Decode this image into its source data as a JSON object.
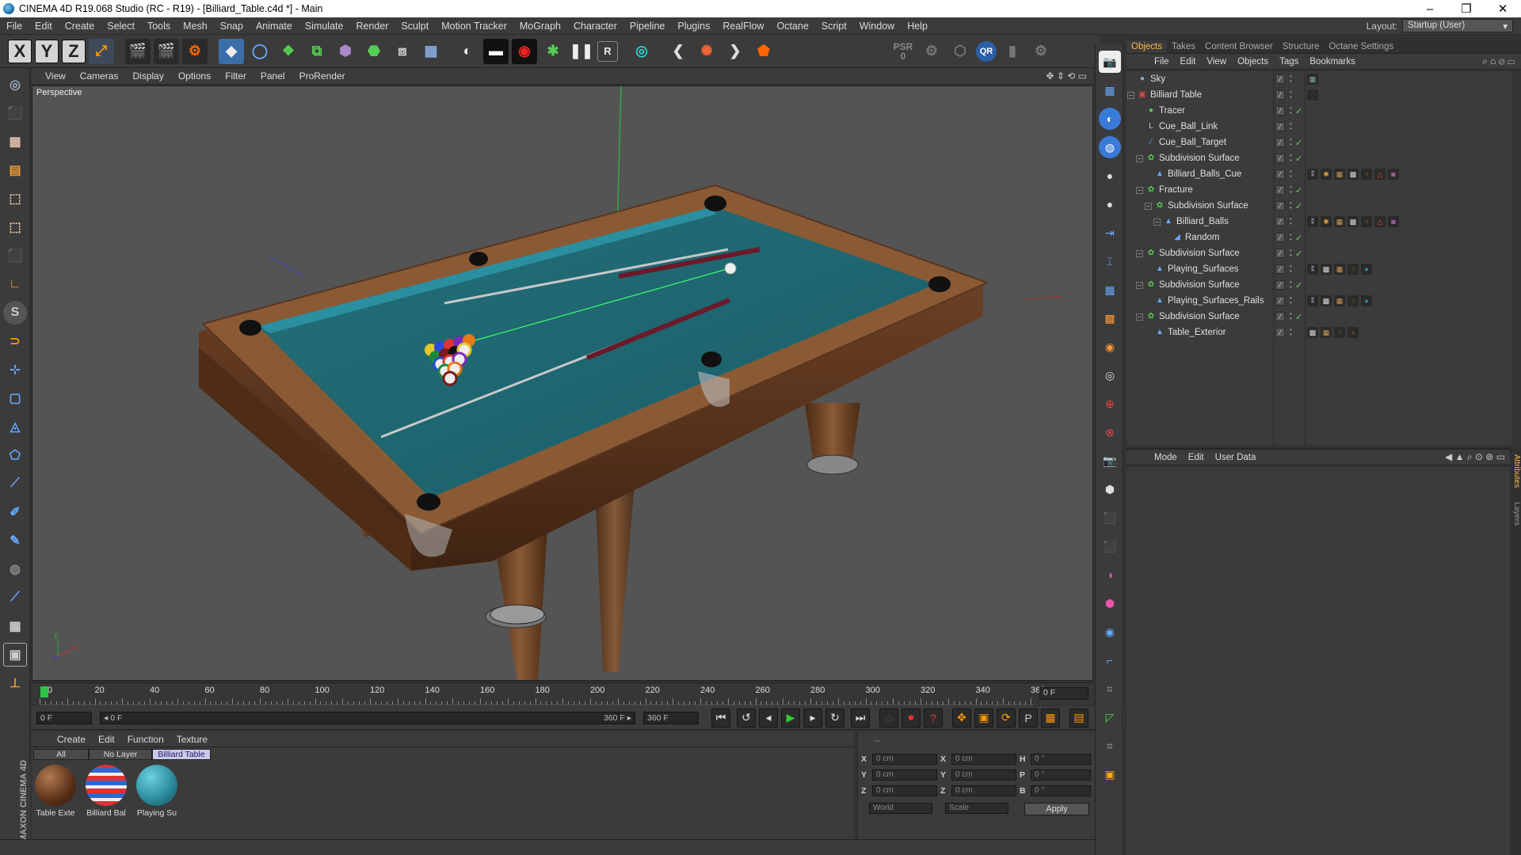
{
  "window": {
    "title": "CINEMA 4D R19.068 Studio (RC - R19) - [Billiard_Table.c4d *] - Main"
  },
  "menu": [
    "File",
    "Edit",
    "Create",
    "Select",
    "Tools",
    "Mesh",
    "Snap",
    "Animate",
    "Simulate",
    "Render",
    "Sculpt",
    "Motion Tracker",
    "MoGraph",
    "Character",
    "Pipeline",
    "Plugins",
    "RealFlow",
    "Octane",
    "Script",
    "Window",
    "Help"
  ],
  "layout": {
    "label": "Layout:",
    "value": "Startup (User)"
  },
  "toolbar": {
    "x": "X",
    "y": "Y",
    "z": "Z",
    "psr": "PSR",
    "psr_value": "0",
    "r_label": "R",
    "qr": "QR"
  },
  "viewport": {
    "menu": [
      "View",
      "Cameras",
      "Display",
      "Options",
      "Filter",
      "Panel",
      "ProRender"
    ],
    "label": "Perspective",
    "axis_x": "x",
    "axis_y": "y"
  },
  "timeline": {
    "ticks": [
      "0",
      "20",
      "40",
      "60",
      "80",
      "100",
      "120",
      "140",
      "160",
      "180",
      "200",
      "220",
      "240",
      "260",
      "280",
      "300",
      "320",
      "340",
      "36("
    ],
    "end_field": "0 F"
  },
  "transport": {
    "current": "0 F",
    "range_start": "◂ 0 F",
    "range_end": "360 F ▸",
    "max": "360 F"
  },
  "materials": {
    "menu": [
      "Create",
      "Edit",
      "Function",
      "Texture"
    ],
    "filters": [
      "All",
      "No Layer",
      "Billiard Table"
    ],
    "items": [
      {
        "label": "Table Exte",
        "color": "#6b3a1e"
      },
      {
        "label": "Billiard Bal",
        "color": "#c9506a"
      },
      {
        "label": "Playing Su",
        "color": "#2d8ea0"
      }
    ]
  },
  "coords": {
    "rows": [
      {
        "a": "X",
        "av": "0 cm",
        "b": "X",
        "bv": "0 cm",
        "c": "H",
        "cv": "0 °"
      },
      {
        "a": "Y",
        "av": "0 cm",
        "b": "Y",
        "bv": "0 cm",
        "c": "P",
        "cv": "0 °"
      },
      {
        "a": "Z",
        "av": "0 cm",
        "b": "Z",
        "bv": "0 cm",
        "c": "B",
        "cv": "0 °"
      }
    ],
    "world": "World",
    "scale": "Scale",
    "apply": "Apply",
    "dashes": "--"
  },
  "panel_tabs": [
    "Objects",
    "Takes",
    "Content Browser",
    "Structure",
    "Octane Settings"
  ],
  "object_menu": [
    "File",
    "Edit",
    "View",
    "Objects",
    "Tags",
    "Bookmarks"
  ],
  "objects": [
    {
      "name": "Sky",
      "indent": 0,
      "expand": "",
      "icon": "●",
      "icolor": "#9ab",
      "check": "",
      "tags": [
        {
          "c": "#8aa",
          "t": "▦"
        }
      ]
    },
    {
      "name": "Billiard Table",
      "indent": 0,
      "expand": "−",
      "icon": "▣",
      "icolor": "#d44",
      "check": "",
      "tags": [
        {
          "c": "#555",
          "t": "⁛"
        }
      ]
    },
    {
      "name": "Tracer",
      "indent": 1,
      "expand": "",
      "icon": "●",
      "icolor": "#5c5",
      "check": "✓",
      "tags": []
    },
    {
      "name": "Cue_Ball_Link",
      "indent": 1,
      "expand": "",
      "icon": "L",
      "icolor": "#ccc",
      "check": "",
      "tags": []
    },
    {
      "name": "Cue_Ball_Target",
      "indent": 1,
      "expand": "",
      "icon": "⁄",
      "icolor": "#6af",
      "check": "✓",
      "tags": []
    },
    {
      "name": "Subdivision Surface",
      "indent": 1,
      "expand": "−",
      "icon": "✿",
      "icolor": "#5c5",
      "check": "✓",
      "tags": []
    },
    {
      "name": "Billiard_Balls_Cue",
      "indent": 2,
      "expand": "",
      "icon": "▲",
      "icolor": "#6af",
      "check": "",
      "tags": [
        {
          "c": "#9ab",
          "t": "⁑"
        },
        {
          "c": "#d94",
          "t": "✱"
        },
        {
          "c": "#c95",
          "t": "▦"
        },
        {
          "c": "#ddd",
          "t": "▩"
        },
        {
          "c": "#e93",
          "t": "⁖"
        },
        {
          "c": "#e44",
          "t": "△"
        },
        {
          "c": "#a6a",
          "t": "◙"
        }
      ]
    },
    {
      "name": "Fracture",
      "indent": 1,
      "expand": "−",
      "icon": "✿",
      "icolor": "#5c5",
      "check": "✓",
      "tags": []
    },
    {
      "name": "Subdivision Surface",
      "indent": 2,
      "expand": "−",
      "icon": "✿",
      "icolor": "#5c5",
      "check": "✓",
      "tags": []
    },
    {
      "name": "Billiard_Balls",
      "indent": 3,
      "expand": "−",
      "icon": "▲",
      "icolor": "#6af",
      "check": "",
      "tags": [
        {
          "c": "#9ab",
          "t": "⁑"
        },
        {
          "c": "#d94",
          "t": "✱"
        },
        {
          "c": "#c95",
          "t": "▦"
        },
        {
          "c": "#ddd",
          "t": "▩"
        },
        {
          "c": "#e93",
          "t": "⁖"
        },
        {
          "c": "#e44",
          "t": "△"
        },
        {
          "c": "#a6a",
          "t": "◙"
        }
      ]
    },
    {
      "name": "Random",
      "indent": 4,
      "expand": "",
      "icon": "◢",
      "icolor": "#6af",
      "check": "✓",
      "tags": []
    },
    {
      "name": "Subdivision Surface",
      "indent": 1,
      "expand": "−",
      "icon": "✿",
      "icolor": "#5c5",
      "check": "✓",
      "tags": []
    },
    {
      "name": "Playing_Surfaces",
      "indent": 2,
      "expand": "",
      "icon": "▲",
      "icolor": "#6af",
      "check": "",
      "tags": [
        {
          "c": "#9ab",
          "t": "⁑"
        },
        {
          "c": "#ddd",
          "t": "▩"
        },
        {
          "c": "#c95",
          "t": "▦"
        },
        {
          "c": "#e93",
          "t": "⁖"
        },
        {
          "c": "#2d8ea0",
          "t": "●"
        }
      ]
    },
    {
      "name": "Subdivision Surface",
      "indent": 1,
      "expand": "−",
      "icon": "✿",
      "icolor": "#5c5",
      "check": "✓",
      "tags": []
    },
    {
      "name": "Playing_Surfaces_Rails",
      "indent": 2,
      "expand": "",
      "icon": "▲",
      "icolor": "#6af",
      "check": "",
      "tags": [
        {
          "c": "#9ab",
          "t": "⁑"
        },
        {
          "c": "#ddd",
          "t": "▩"
        },
        {
          "c": "#c95",
          "t": "▦"
        },
        {
          "c": "#e93",
          "t": "⁖"
        },
        {
          "c": "#2d8ea0",
          "t": "●"
        }
      ]
    },
    {
      "name": "Subdivision Surface",
      "indent": 1,
      "expand": "−",
      "icon": "✿",
      "icolor": "#5c5",
      "check": "✓",
      "tags": []
    },
    {
      "name": "Table_Exterior",
      "indent": 2,
      "expand": "",
      "icon": "▲",
      "icolor": "#6af",
      "check": "",
      "tags": [
        {
          "c": "#ddd",
          "t": "▩"
        },
        {
          "c": "#c95",
          "t": "▦"
        },
        {
          "c": "#e93",
          "t": "⁖"
        },
        {
          "c": "#6b3a1e",
          "t": "●"
        }
      ]
    }
  ],
  "attributes_menu": [
    "Mode",
    "Edit",
    "User Data"
  ],
  "side_tabs": [
    "Attributes",
    "Layers"
  ],
  "maxon": "MAXON CINEMA 4D",
  "colors": {
    "accent": "#ffb84d",
    "felt": "#1f6f78",
    "wood": "#6b3a1e",
    "bg": "#3b3b3b"
  }
}
